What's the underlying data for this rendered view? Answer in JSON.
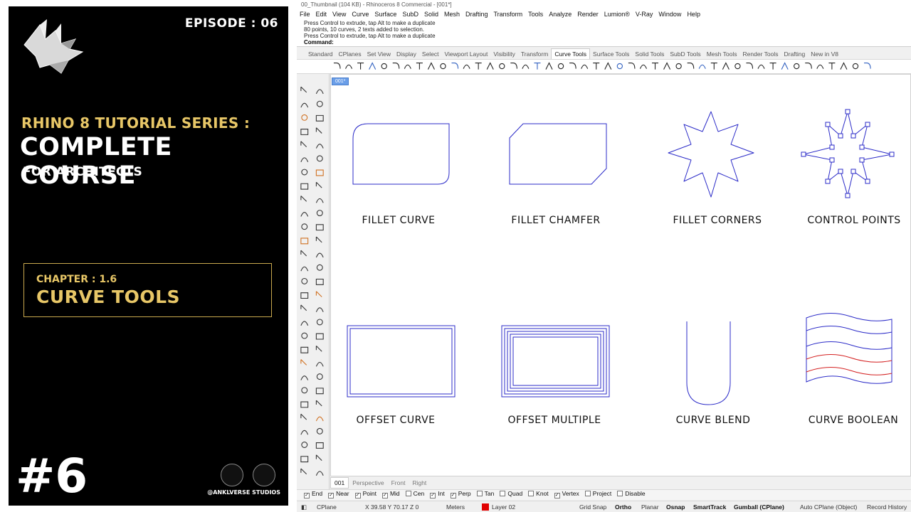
{
  "promo": {
    "episode": "EPISODE : 06",
    "series": "RHINO 8 TUTORIAL SERIES :",
    "course": "COMPLETE COURSE",
    "audience": "FOR ARCHITECTS",
    "chapter_number": "CHAPTER : 1.6",
    "chapter_title": "CURVE TOOLS",
    "big_number": "#6",
    "studio": "@ANKLVERSE STUDIOS",
    "accent": "#e8c767"
  },
  "window": {
    "title": "00_Thumbnail (104 KB) - Rhinoceros 8 Commercial - [001*]",
    "menu": [
      "File",
      "Edit",
      "View",
      "Curve",
      "Surface",
      "SubD",
      "Solid",
      "Mesh",
      "Drafting",
      "Transform",
      "Tools",
      "Analyze",
      "Render",
      "Lumion®",
      "V-Ray",
      "Window",
      "Help"
    ],
    "history": [
      "Press Control to extrude, tap Alt to make a duplicate",
      "80 points, 10 curves, 2 texts added to selection.",
      "Press Control to extrude, tap Alt to make a duplicate"
    ],
    "command_label": "Command:",
    "tabs": [
      "Standard",
      "CPlanes",
      "Set View",
      "Display",
      "Select",
      "Viewport Layout",
      "Visibility",
      "Transform",
      "Curve Tools",
      "Surface Tools",
      "Solid Tools",
      "SubD Tools",
      "Mesh Tools",
      "Render Tools",
      "Drafting",
      "New in V8"
    ],
    "active_tab": "Curve Tools",
    "viewport_tab": "001*"
  },
  "viewport": {
    "captions": [
      "FILLET CURVE",
      "FILLET CHAMFER",
      "FILLET CORNERS",
      "CONTROL POINTS",
      "OFFSET CURVE",
      "OFFSET MULTIPLE",
      "CURVE BLEND",
      "CURVE BOOLEAN"
    ],
    "curve_color": "#2b2bc8",
    "highlight_color": "#d42020"
  },
  "viewport_tabs": [
    "001",
    "Perspective",
    "Front",
    "Right"
  ],
  "osnap": [
    {
      "label": "End",
      "checked": true
    },
    {
      "label": "Near",
      "checked": true
    },
    {
      "label": "Point",
      "checked": true
    },
    {
      "label": "Mid",
      "checked": true
    },
    {
      "label": "Cen",
      "checked": false
    },
    {
      "label": "Int",
      "checked": true
    },
    {
      "label": "Perp",
      "checked": true
    },
    {
      "label": "Tan",
      "checked": false
    },
    {
      "label": "Quad",
      "checked": false
    },
    {
      "label": "Knot",
      "checked": false
    },
    {
      "label": "Vertex",
      "checked": true
    },
    {
      "label": "Project",
      "checked": false
    },
    {
      "label": "Disable",
      "checked": false
    }
  ],
  "status": {
    "cplane": "CPlane",
    "coords": "X 39.58 Y 70.17 Z 0",
    "units": "Meters",
    "layer": "Layer 02",
    "layer_color": "#e00000",
    "grid_snap": "Grid Snap",
    "ortho": "Ortho",
    "planar": "Planar",
    "osnap": "Osnap",
    "smarttrack": "SmartTrack",
    "gumball": "Gumball (CPlane)",
    "auto_cplane": "Auto CPlane (Object)",
    "record_history": "Record History"
  }
}
